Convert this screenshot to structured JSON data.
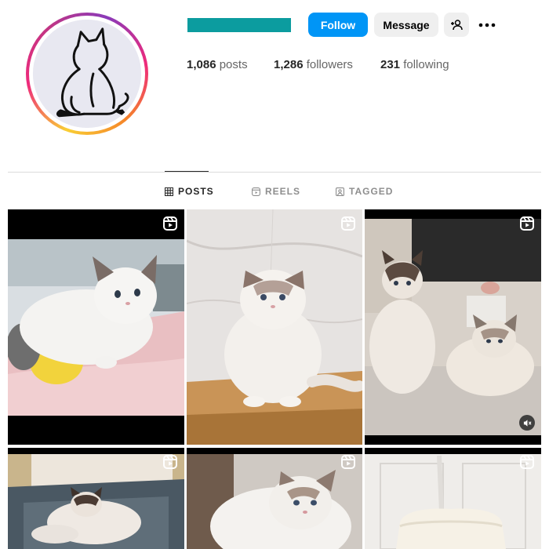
{
  "profile": {
    "stats": {
      "posts_count": "1,086",
      "posts_label": "posts",
      "followers_count": "1,286",
      "followers_label": "followers",
      "following_count": "231",
      "following_label": "following"
    },
    "buttons": {
      "follow": "Follow",
      "message": "Message"
    }
  },
  "colors": {
    "username_redaction": "#0c9c9f",
    "follow_button": "#0095f6"
  },
  "tabs": [
    {
      "label": "POSTS",
      "icon": "grid-icon",
      "active": true
    },
    {
      "label": "REELS",
      "icon": "reels-icon",
      "active": false
    },
    {
      "label": "TAGGED",
      "icon": "tagged-icon",
      "active": false
    }
  ],
  "grid": {
    "tiles": [
      {
        "kind": "reel",
        "subject": "ragdoll-kitten-on-pink-blanket"
      },
      {
        "kind": "reel",
        "subject": "ragdoll-cat-on-wooden-shelf"
      },
      {
        "kind": "reel",
        "subject": "two-ragdoll-cats-indoors",
        "muted": true
      },
      {
        "kind": "reel",
        "subject": "ragdoll-cat-in-cat-bed"
      },
      {
        "kind": "reel",
        "subject": "ragdoll-cat-closeup"
      },
      {
        "kind": "reel",
        "subject": "white-armchair-room"
      }
    ]
  }
}
